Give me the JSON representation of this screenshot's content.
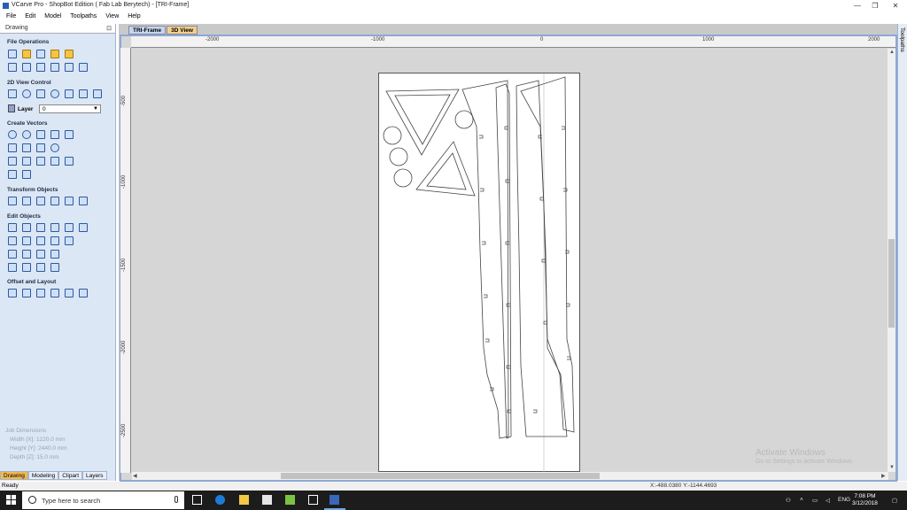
{
  "window": {
    "title": "VCarve Pro - ShopBot Edition ( Fab Lab Berytech) - [TRI-Frame]",
    "minimize": "—",
    "restore": "❐",
    "close": "✕"
  },
  "menu": [
    "File",
    "Edit",
    "Model",
    "Toolpaths",
    "View",
    "Help"
  ],
  "left_panel": {
    "header": "Drawing",
    "pin": "⊡",
    "sections": {
      "file_ops": "File Operations",
      "view_control": "2D View Control",
      "create_vectors": "Create Vectors",
      "transform": "Transform Objects",
      "edit_objects": "Edit Objects",
      "offset_layout": "Offset and Layout"
    },
    "layer": {
      "label": "Layer",
      "value": "0",
      "arrow": "▼"
    },
    "job_dimensions": {
      "title": "Job Dimensions",
      "width": "Width  [X]: 1220.0 mm",
      "height": "Height [Y]: 2440.0 mm",
      "depth": "Depth  [Z]: 15.0 mm"
    },
    "tabs": [
      "Drawing",
      "Modeling",
      "Clipart",
      "Layers"
    ]
  },
  "doc_tabs": [
    "TRI-Frame",
    "3D View"
  ],
  "ruler": {
    "h_ticks": [
      "-2000",
      "-1000",
      "0",
      "1000",
      "2000"
    ],
    "v_ticks": [
      "-500",
      "-1000",
      "-1500",
      "-2000",
      "-2500"
    ]
  },
  "right_panel": {
    "label": "Toolpaths"
  },
  "scroll": {
    "up": "▲",
    "down": "▼",
    "left": "◀",
    "right": "▶"
  },
  "watermark": {
    "line1": "Activate Windows",
    "line2": "Go to Settings to activate Windows."
  },
  "status": {
    "left": "Ready",
    "coords": "X:-488.0380 Y:-1144.4693"
  },
  "taskbar": {
    "search_placeholder": "Type here to search",
    "lang": "ENG",
    "time": "7:08 PM",
    "date": "3/12/2018"
  },
  "colors": {
    "panel_bg": "#dce7f5",
    "accent": "#2c5aa0",
    "active_tab": "#f2b84b",
    "taskbar": "#1c1c1c"
  }
}
